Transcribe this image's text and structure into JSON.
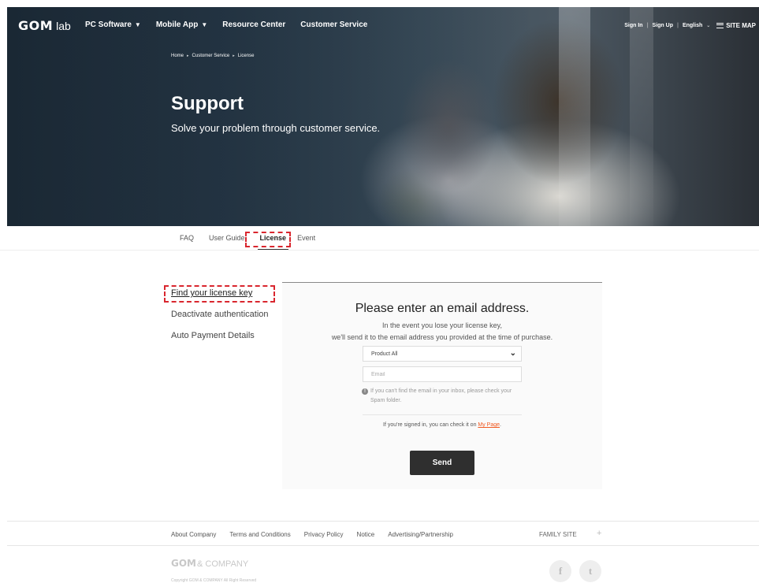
{
  "header": {
    "logo_main": "GOM",
    "logo_suffix": "lab",
    "menu": [
      {
        "label": "PC Software",
        "has_dropdown": true
      },
      {
        "label": "Mobile App",
        "has_dropdown": true
      },
      {
        "label": "Resource Center",
        "has_dropdown": false
      },
      {
        "label": "Customer Service",
        "has_dropdown": false
      }
    ],
    "util": {
      "sign_in": "Sign In",
      "sign_up": "Sign Up",
      "language": "English",
      "site_map": "SITE MAP"
    }
  },
  "hero": {
    "breadcrumb": [
      "Home",
      "Customer Service",
      "License"
    ],
    "title": "Support",
    "subtitle": "Solve your problem through customer service."
  },
  "subnav": {
    "tabs": [
      "FAQ",
      "User Guide",
      "License",
      "Event"
    ],
    "active": "License"
  },
  "sidemenu": {
    "items": [
      "Find your license key",
      "Deactivate authentication",
      "Auto Payment Details"
    ],
    "active": "Find your license key"
  },
  "form": {
    "heading": "Please enter an email address.",
    "desc_line1": "In the event you lose your license key,",
    "desc_line2": "we'll send it to the email address you provided at the time of purchase.",
    "product_select": "Product All",
    "email_placeholder": "Email",
    "notice": "If you can't find the email in your inbox, please check your Spam folder.",
    "mypage_prefix": "If you're signed in, you can check it on ",
    "mypage_link": "My Page",
    "mypage_suffix": ".",
    "send_label": "Send"
  },
  "footer": {
    "links": [
      "About Company",
      "Terms and Conditions",
      "Privacy Policy",
      "Notice",
      "Advertising/Partnership"
    ],
    "family_site": "FAMILY SITE",
    "family_plus": "+",
    "logo_main": "GOM",
    "logo_suffix": "& COMPANY",
    "copyright": "Copyright GOM & COMPANY All Right Reserved"
  },
  "icons": {
    "dropdown": "chevron-down-icon",
    "info": "info-icon",
    "menu": "hamburger-icon",
    "facebook": "facebook-icon",
    "twitter": "twitter-icon"
  },
  "colors": {
    "accent_link": "#f05a22",
    "highlight_dash": "#d9262e",
    "send_button": "#2f2f2f"
  }
}
